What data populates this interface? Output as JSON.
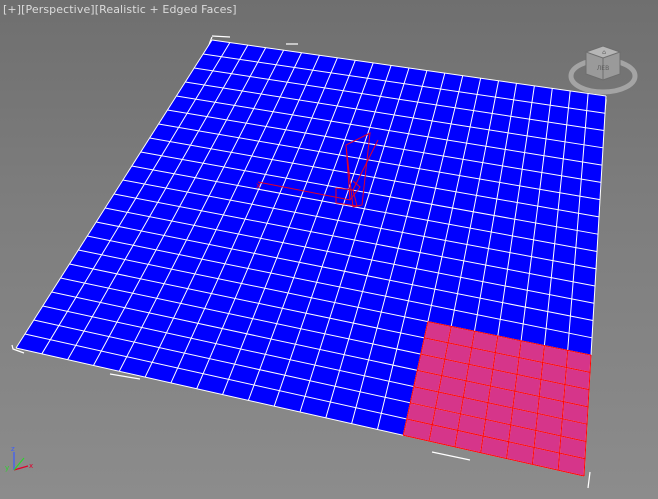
{
  "viewport": {
    "menu_plus": "[+]",
    "view_mode": "[Perspective]",
    "shading_mode": "[Realistic + Edged Faces]"
  },
  "viewcube": {
    "face_label": "ЛЕВ"
  },
  "axis_tripod": {
    "x": "x",
    "y": "y",
    "z": "z"
  },
  "scene": {
    "plane_color": "#0000ff",
    "grid_line_color": "#ffffff",
    "selection_color": "#d6358a",
    "selection_edge_color": "#ff0000",
    "grid_segments": [
      22,
      22
    ],
    "selected_region": {
      "cols": [
        15,
        22
      ],
      "rows": [
        15,
        22
      ]
    }
  },
  "colors": {
    "label_text": "#dcdcdc",
    "background_top": "#6f6f6f",
    "background_bottom": "#8c8c8c",
    "gizmo": "#e0002c"
  }
}
